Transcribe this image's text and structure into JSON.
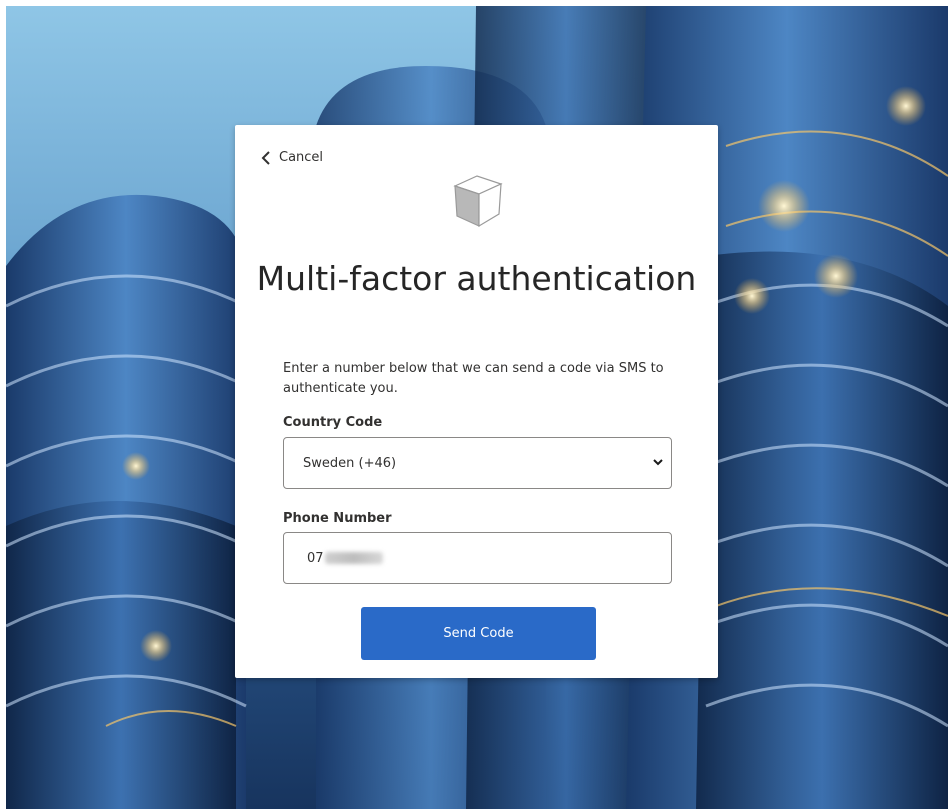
{
  "nav": {
    "cancel_label": "Cancel"
  },
  "logo": {
    "icon": "cube-icon"
  },
  "title": "Multi-factor authentication",
  "description": "Enter a number below that we can send a code via SMS to authenticate you.",
  "country_code": {
    "label": "Country Code",
    "selected": "Sweden (+46)"
  },
  "phone_number": {
    "label": "Phone Number",
    "value_prefix": "07"
  },
  "send_button": {
    "label": "Send Code"
  },
  "colors": {
    "accent": "#2a6ac8",
    "text": "#323130",
    "title": "#262626"
  }
}
